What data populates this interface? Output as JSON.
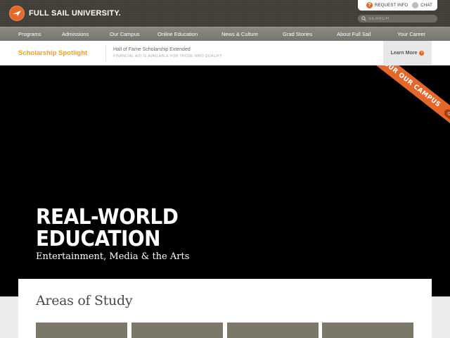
{
  "header": {
    "logo_text": "FULL SAIL UNIVERSITY.",
    "utility": {
      "request_info": "REQUEST INFO",
      "chat": "CHAT"
    },
    "search_placeholder": "SEARCH"
  },
  "nav": {
    "items": [
      {
        "label": "Programs"
      },
      {
        "label": "Admissions"
      },
      {
        "label": "Our Campus"
      },
      {
        "label": "Online Education"
      },
      {
        "label": "News & Culture"
      },
      {
        "label": "Grad Stories"
      },
      {
        "label": "About Full Sail"
      },
      {
        "label": "Your Career"
      }
    ]
  },
  "spotlight": {
    "title": "Scholarship Spotlight",
    "headline": "Hall of Fame Scholarship Extended",
    "subtext": "FINANCIAL AID IS AVAILABLE FOR THOSE WHO QUALIFY",
    "learn_more": "Learn More"
  },
  "hero": {
    "title": "REAL-WORLD\nEDUCATION",
    "subtitle": "Entertainment, Media & the Arts",
    "ribbon_text": "TOUR OUR CAMPUS",
    "ribbon_button": "Get Info"
  },
  "study": {
    "title": "Areas of Study"
  },
  "colors": {
    "brand_orange": "#e4672b",
    "spotlight_gold": "#e8a321",
    "header_dark": "#3f3d36",
    "nav_gray": "#807f77",
    "card_taupe": "#7b7869"
  }
}
